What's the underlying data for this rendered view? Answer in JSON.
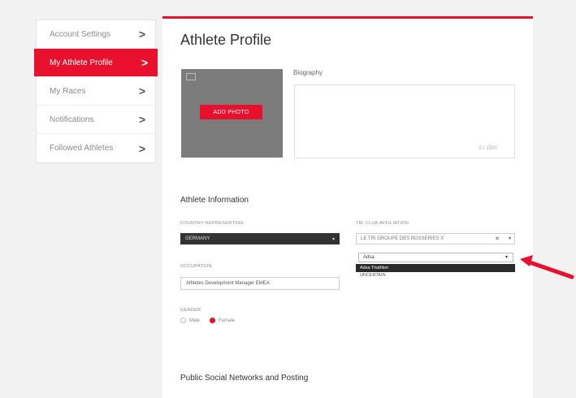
{
  "sidebar": {
    "items": [
      {
        "label": "Account Settings",
        "active": false
      },
      {
        "label": "My Athlete Profile",
        "active": true
      },
      {
        "label": "My Races",
        "active": false
      },
      {
        "label": "Notifications",
        "active": false
      },
      {
        "label": "Followed Athletes",
        "active": false
      }
    ],
    "chevron": ">"
  },
  "main": {
    "title": "Athlete Profile",
    "photo": {
      "button_label": "ADD PHOTO",
      "icon": "camera-icon"
    },
    "biography": {
      "label": "Biography",
      "value": "",
      "char_count": "0 / 1500"
    },
    "athlete_info": {
      "title": "Athlete Information",
      "country_label": "COUNTRY REPRESENTING",
      "country_value": "GERMANY",
      "occupation_label": "OCCUPATION",
      "occupation_value": "Athletes Development Manager EMEA",
      "gender_label": "GENDER",
      "gender_options": [
        "Male",
        "Female"
      ],
      "gender_selected": "Female",
      "tri_club_label": "TRI CLUB AFFILIATION",
      "tri_club_value": "LE TRI GROUPE DES BOSSERIES X",
      "tri_club_search": "Adsa",
      "tri_club_options": [
        "Adsa Triathlon",
        "UNCERTAIN"
      ]
    },
    "social": {
      "title": "Public Social Networks and Posting"
    }
  },
  "colors": {
    "accent": "#e8102d",
    "dark": "#333333"
  }
}
